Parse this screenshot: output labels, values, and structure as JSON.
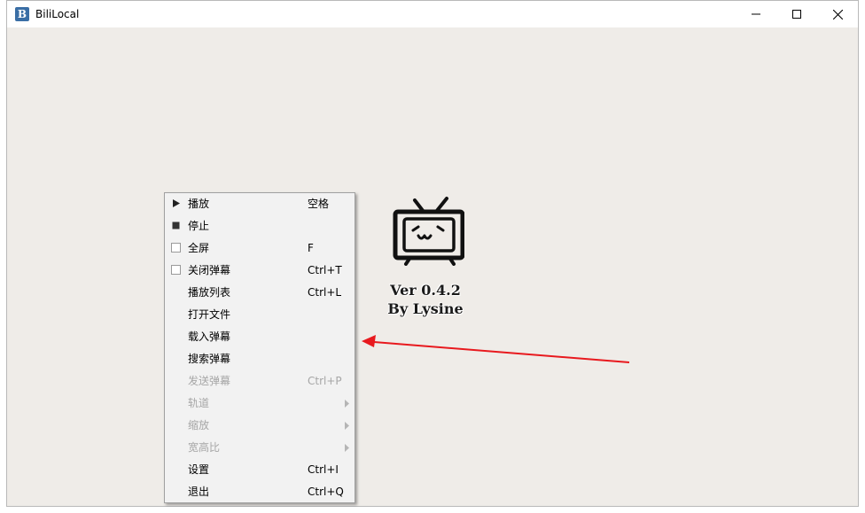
{
  "window": {
    "app_icon_letter": "B",
    "title": "BiliLocal"
  },
  "splash": {
    "logo_icon": "bilibili-tv-icon",
    "version": "Ver 0.4.2",
    "author": "By Lysine"
  },
  "annotation": {
    "arrow_color": "#e8191e"
  },
  "menu": {
    "items": [
      {
        "label": "播放",
        "shortcut": "空格",
        "indicator": "play-icon",
        "enabled": true
      },
      {
        "label": "停止",
        "shortcut": "",
        "indicator": "stop-icon",
        "enabled": true
      },
      {
        "label": "全屏",
        "shortcut": "F",
        "indicator": "checkbox",
        "enabled": true
      },
      {
        "label": "关闭弹幕",
        "shortcut": "Ctrl+T",
        "indicator": "checkbox",
        "enabled": true
      },
      {
        "label": "播放列表",
        "shortcut": "Ctrl+L",
        "indicator": "",
        "enabled": true
      },
      {
        "label": "打开文件",
        "shortcut": "",
        "indicator": "",
        "enabled": true
      },
      {
        "label": "载入弹幕",
        "shortcut": "",
        "indicator": "",
        "enabled": true
      },
      {
        "label": "搜索弹幕",
        "shortcut": "",
        "indicator": "",
        "enabled": true
      },
      {
        "label": "发送弹幕",
        "shortcut": "Ctrl+P",
        "indicator": "",
        "enabled": false
      },
      {
        "label": "轨道",
        "shortcut": "",
        "indicator": "",
        "enabled": false,
        "submenu": true
      },
      {
        "label": "缩放",
        "shortcut": "",
        "indicator": "",
        "enabled": false,
        "submenu": true
      },
      {
        "label": "宽高比",
        "shortcut": "",
        "indicator": "",
        "enabled": false,
        "submenu": true
      },
      {
        "label": "设置",
        "shortcut": "Ctrl+I",
        "indicator": "",
        "enabled": true
      },
      {
        "label": "退出",
        "shortcut": "Ctrl+Q",
        "indicator": "",
        "enabled": true
      }
    ]
  }
}
